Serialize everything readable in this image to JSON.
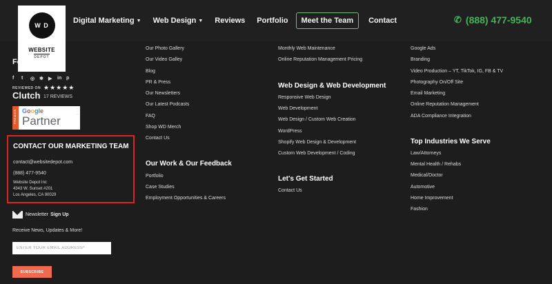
{
  "nav": {
    "logo": {
      "mark": "W D",
      "word1": "WEBSITE",
      "word2": "DEPOT"
    },
    "items": [
      {
        "label": "Digital Marketing",
        "has_dropdown": true
      },
      {
        "label": "Web Design",
        "has_dropdown": true
      },
      {
        "label": "Reviews",
        "has_dropdown": false
      },
      {
        "label": "Portfolio",
        "has_dropdown": false
      }
    ],
    "team_button": "Meet the Team",
    "contact": "Contact",
    "phone": "(888) 477-9540"
  },
  "left": {
    "follow_heading": "Fo",
    "social_icons": [
      "facebook-icon",
      "twitter-icon",
      "instagram-icon",
      "yelp-icon",
      "youtube-icon",
      "linkedin-icon",
      "pinterest-icon"
    ],
    "reviewed_on": "REVIEWED ON",
    "clutch": "Clutch",
    "stars": "★★★★★",
    "review_count": "17 REVIEWS",
    "partner": {
      "premier": "PREMIER",
      "google": [
        "G",
        "o",
        "o",
        "g",
        "l",
        "e"
      ],
      "word": "Partner"
    },
    "contact": {
      "title": "CONTACT OUR MARKETING TEAM",
      "email": "contact@websitedepot.com",
      "phone": "(888) 477-9540",
      "address1": "Website Depot Inc",
      "address2": "4343 W. Sunset #201",
      "address3": "Los Angeles, CA 90029"
    },
    "newsletter_prefix": "Newsletter",
    "newsletter_bold": "Sign Up",
    "receive": "Receive News, Updates & More!",
    "email_placeholder": "ENTER YOUR EMAIL ADDRESS*",
    "subscribe": "SUBSCRIBE"
  },
  "col1": {
    "links_top": [
      "Our Photo Gallery",
      "Our Video Galley",
      "Blog",
      "PR & Press",
      "Our Newsletters",
      "Our Latest Podcasts",
      "FAQ",
      "Shop WD Merch",
      "Contact Us"
    ],
    "heading": "Our Work & Our Feedback",
    "links_bottom": [
      "Portfolio",
      "Case Studies",
      "Employment Opportunities & Careers"
    ]
  },
  "col2": {
    "links_top": [
      "Monthly Web Maintenance",
      "Online Reputation Management Pricing"
    ],
    "heading1": "Web Design & Web Development",
    "links_mid": [
      "Responsive Web Design",
      "Web Development",
      "Web Design / Custom Web Creation",
      "WordPress",
      "Shopify Web Design & Development",
      "Custom Web Development / Coding"
    ],
    "heading2": "Let's Get Started",
    "links_bottom": [
      "Contact Us"
    ]
  },
  "col3": {
    "links_top": [
      "Google Ads",
      "Branding",
      "Video Production – YT, TikTok, IG, FB & TV",
      "Photography On/Off Site",
      "Email Marketing",
      "Online Reputation Management",
      "ADA Compliance Integration"
    ],
    "heading": "Top Industries We Serve",
    "links_bottom": [
      "Law/Attorneys",
      "Mental Health / Rehabs",
      "Medical/Doctor",
      "Automotive",
      "Home Improvement",
      "Fashion"
    ]
  }
}
